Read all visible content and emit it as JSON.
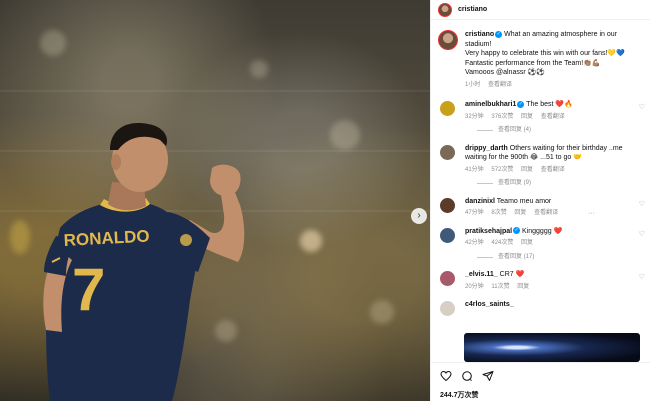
{
  "header": {
    "username": "cristiano"
  },
  "post": {
    "username": "cristiano",
    "caption_line1": "What an amazing atmosphere in our stadium!",
    "caption_line2": "Very happy to celebrate this win with our fans!💛💙",
    "caption_line3": "Fantastic performance from the Team!👏🏽💪🏽",
    "caption_line4": "Vamooos @alnassr ⚽⚽",
    "time": "1小时",
    "translate": "查看翻译",
    "likes": "244.7万次赞"
  },
  "photo": {
    "jersey_name": "RONALDO",
    "jersey_number": "7"
  },
  "comments": [
    {
      "username": "aminelbukhari1",
      "text": "The best ❤️🔥",
      "time": "32分钟",
      "likes": "376次赞",
      "reply": "回复",
      "translate": "查看翻译",
      "view_replies": "查看回复 (4)"
    },
    {
      "username": "drippy_darth",
      "text": "Others waiting for their birthday ..me waiting for the 900th 😂 ...51 to go 🤝",
      "time": "41分钟",
      "likes": "572次赞",
      "reply": "回复",
      "translate": "查看翻译",
      "view_replies": "查看回复 (9)"
    },
    {
      "username": "danzinixl",
      "text": "Teamo meu amor",
      "time": "47分钟",
      "likes": "8次赞",
      "reply": "回复",
      "translate": "查看翻译"
    },
    {
      "username": "pratiksehajpal",
      "text": "Kinggggg ❤️",
      "time": "42分钟",
      "likes": "424次赞",
      "reply": "回复",
      "view_replies": "查看回复 (17)"
    },
    {
      "username": "_elvis.11_",
      "text": "CR7 ❤️",
      "time": "20分钟",
      "likes": "11次赞",
      "reply": "回复"
    },
    {
      "username": "c4rlos_saints_",
      "text": ""
    }
  ],
  "colors": {
    "accent": "#0095f6",
    "heart": "#ed4956",
    "jersey": "#1d2b4a",
    "jersey_trim": "#e0b84b"
  },
  "icons": [
    "heart-icon",
    "comment-icon",
    "share-icon",
    "more-icon",
    "chevron-right-icon",
    "verified-icon"
  ]
}
